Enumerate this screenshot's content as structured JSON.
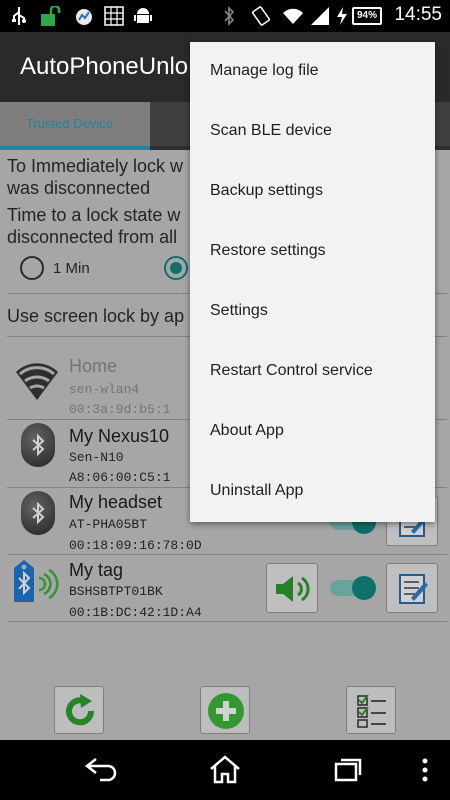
{
  "status_bar": {
    "time": "14:55",
    "battery": "94%",
    "icons": [
      "usb-icon",
      "unlock-icon",
      "chart-icon",
      "grid-icon",
      "android-icon",
      "bluetooth-icon",
      "rotation-icon",
      "wifi-icon",
      "signal-icon",
      "charging-icon"
    ]
  },
  "action_bar": {
    "title": "AutoPhoneUnlo"
  },
  "tabs": {
    "active_label": "Trusted Device"
  },
  "main": {
    "lock_line1": "To Immediately lock w",
    "lock_line2": "was disconnected",
    "time_line1": "Time to a lock state w",
    "time_line2": "disconnected from all",
    "radio_1min": "1 Min",
    "screen_lock": "Use screen lock by ap"
  },
  "devices": [
    {
      "name": "Home",
      "network": "sen-wlan4",
      "address": "00:3a:9d:b5:1",
      "icon": "wifi-icon",
      "enabled": false
    },
    {
      "name": "My Nexus10",
      "network": "Sen-N10",
      "address": "A8:06:00:C5:1",
      "icon": "bluetooth-icon",
      "enabled": true
    },
    {
      "name": "My headset",
      "network": "AT-PHA05BT",
      "address": "00:18:09:16:78:0D",
      "icon": "bluetooth-icon",
      "enabled": true
    },
    {
      "name": "My tag",
      "network": "BSHSBTPT01BK",
      "address": "00:1B:DC:42:1D:A4",
      "icon": "bluetooth-tag-icon",
      "enabled": true
    }
  ],
  "menu": {
    "items": [
      "Manage log file",
      "Scan BLE device",
      "Backup settings",
      "Restore settings",
      "Settings",
      "Restart Control service",
      "About App",
      "Uninstall App"
    ]
  },
  "toolbar": {
    "buttons": [
      "refresh-icon",
      "add-icon",
      "checklist-icon"
    ]
  },
  "nav": {
    "buttons": [
      "back-icon",
      "home-icon",
      "recents-icon",
      "more-icon"
    ]
  },
  "colors": {
    "accent": "#0f8a80",
    "tab_underline": "#27a3c4",
    "add_green": "#3dbb3d"
  }
}
